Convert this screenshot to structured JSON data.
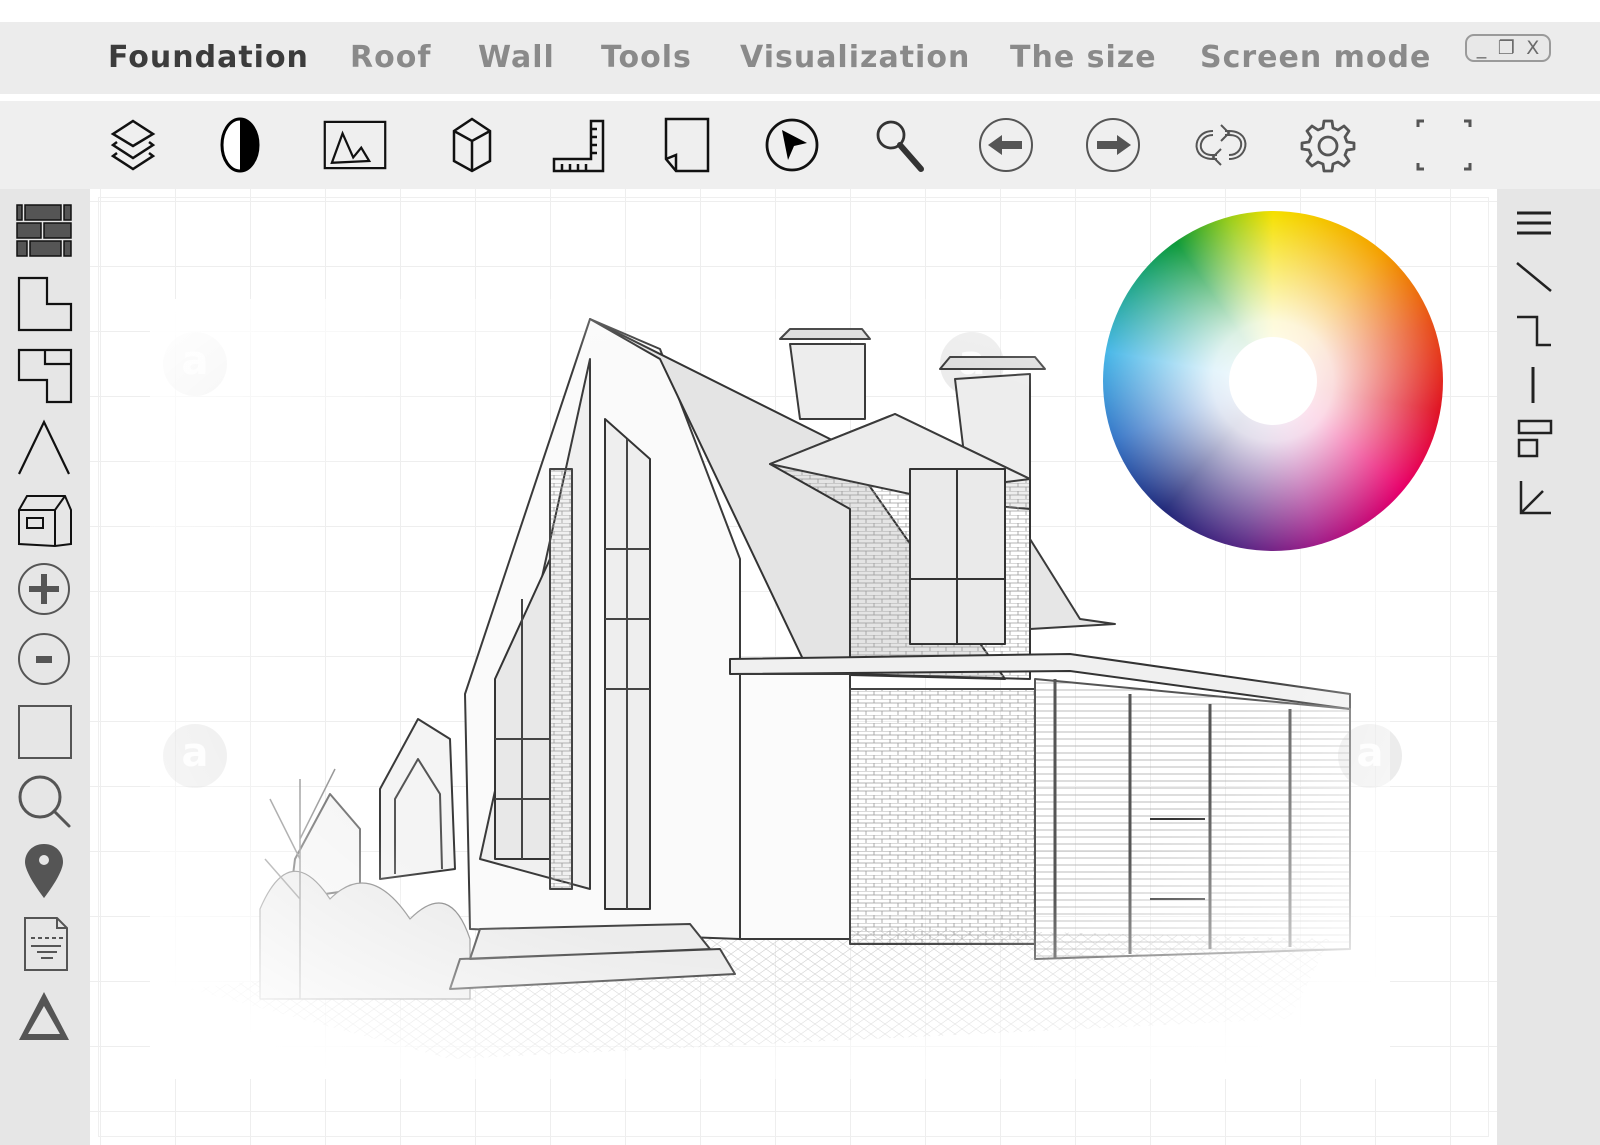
{
  "menu": {
    "items": [
      {
        "label": "Foundation",
        "active": true
      },
      {
        "label": "Roof",
        "active": false
      },
      {
        "label": "Wall",
        "active": false
      },
      {
        "label": "Tools",
        "active": false
      },
      {
        "label": "Visualization",
        "active": false
      },
      {
        "label": "The size",
        "active": false
      },
      {
        "label": "Screen mode",
        "active": false
      }
    ]
  },
  "window_controls": {
    "minimize": "_",
    "restore": "❐",
    "close": "X"
  },
  "toolbar": {
    "tools": [
      {
        "icon": "layers-icon"
      },
      {
        "icon": "contrast-icon"
      },
      {
        "icon": "image-icon"
      },
      {
        "icon": "cube-icon"
      },
      {
        "icon": "ruler-icon"
      },
      {
        "icon": "page-icon"
      },
      {
        "icon": "cursor-icon"
      },
      {
        "icon": "search-icon"
      },
      {
        "icon": "arrow-left-icon"
      },
      {
        "icon": "arrow-right-icon"
      },
      {
        "icon": "sync-icon"
      },
      {
        "icon": "gear-icon"
      },
      {
        "icon": "fullscreen-icon"
      }
    ]
  },
  "left_sidebar": {
    "tools": [
      {
        "icon": "brick-wall-icon"
      },
      {
        "icon": "l-shape-icon"
      },
      {
        "icon": "floor-plan-icon"
      },
      {
        "icon": "roof-icon"
      },
      {
        "icon": "house-icon"
      },
      {
        "icon": "zoom-in-icon"
      },
      {
        "icon": "zoom-out-icon"
      },
      {
        "icon": "rectangle-icon"
      },
      {
        "icon": "search-icon"
      },
      {
        "icon": "location-pin-icon"
      },
      {
        "icon": "document-icon"
      },
      {
        "icon": "triangle-icon"
      }
    ]
  },
  "right_sidebar": {
    "tools": [
      {
        "icon": "menu-icon"
      },
      {
        "icon": "diagonal-line-icon"
      },
      {
        "icon": "step-line-icon"
      },
      {
        "icon": "vertical-line-icon"
      },
      {
        "icon": "align-icon"
      },
      {
        "icon": "arrow-down-left-icon"
      }
    ]
  },
  "canvas": {
    "content": "house-sketch",
    "color_picker": "color-wheel"
  }
}
